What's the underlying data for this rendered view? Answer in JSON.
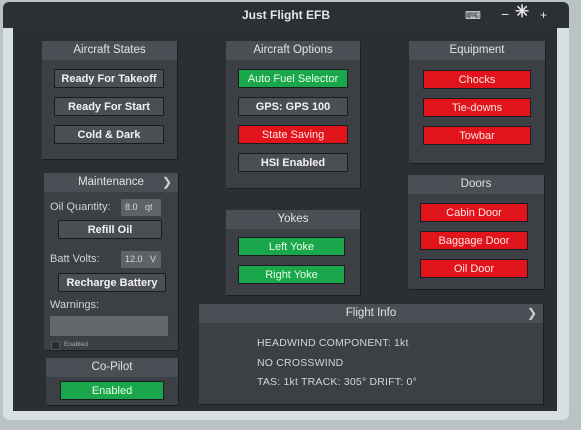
{
  "window": {
    "title": "Just Flight EFB"
  },
  "aircraft_states": {
    "title": "Aircraft States",
    "buttons": [
      "Ready For Takeoff",
      "Ready For Start",
      "Cold & Dark"
    ]
  },
  "aircraft_options": {
    "title": "Aircraft Options",
    "buttons": [
      "Auto Fuel Selector",
      "GPS: GPS 100",
      "State Saving",
      "HSI Enabled"
    ]
  },
  "equipment": {
    "title": "Equipment",
    "buttons": [
      "Chocks",
      "Tie-downs",
      "Towbar"
    ]
  },
  "maintenance": {
    "title": "Maintenance",
    "oil_label": "Oil Quantity:",
    "oil_value": "8.0",
    "oil_unit": "qt",
    "refill": "Refill Oil",
    "batt_label": "Batt Volts:",
    "batt_value": "12.0",
    "batt_unit": "V",
    "recharge": "Recharge Battery",
    "warnings_label": "Warnings:",
    "enabled_small": "Enabled"
  },
  "yokes": {
    "title": "Yokes",
    "buttons": [
      "Left Yoke",
      "Right Yoke"
    ]
  },
  "doors": {
    "title": "Doors",
    "buttons": [
      "Cabin Door",
      "Baggage Door",
      "Oil Door"
    ]
  },
  "copilot": {
    "title": "Co-Pilot",
    "button": "Enabled"
  },
  "flight_info": {
    "title": "Flight Info",
    "lines": [
      "HEADWIND COMPONENT:  1kt",
      "NO CROSSWIND",
      "TAS:  1kt TRACK: 305° DRIFT:  0°"
    ]
  },
  "colors": {
    "on": "#1aa64a",
    "off": "#e2141b",
    "neutral": "#4b4f54",
    "panel": "#3c4045"
  }
}
